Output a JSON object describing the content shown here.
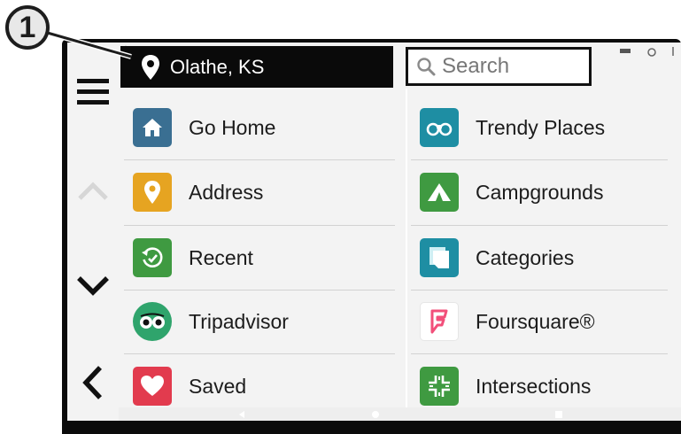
{
  "callout": {
    "number": "1"
  },
  "header": {
    "location": "Olathe, KS",
    "search_placeholder": "Search"
  },
  "colors": {
    "go_home": "#3a6f92",
    "address": "#e6a421",
    "recent": "#3f9a41",
    "tripadvisor": "#2fa46c",
    "saved": "#e23b4e",
    "trendy": "#1e8ea3",
    "campgrounds": "#3f9a41",
    "categories": "#1e8ea3",
    "foursquare": "#f24f7a",
    "intersections": "#3f9a41"
  },
  "menu": {
    "left": [
      {
        "label": "Go Home",
        "icon": "home-icon"
      },
      {
        "label": "Address",
        "icon": "map-pin-icon"
      },
      {
        "label": "Recent",
        "icon": "history-icon"
      },
      {
        "label": "Tripadvisor",
        "icon": "tripadvisor-owl-icon"
      },
      {
        "label": "Saved",
        "icon": "heart-icon"
      }
    ],
    "right": [
      {
        "label": "Trendy Places",
        "icon": "binoculars-icon"
      },
      {
        "label": "Campgrounds",
        "icon": "tent-icon"
      },
      {
        "label": "Categories",
        "icon": "categories-icon"
      },
      {
        "label": "Foursquare®",
        "icon": "foursquare-icon"
      },
      {
        "label": "Intersections",
        "icon": "intersection-icon"
      }
    ]
  }
}
